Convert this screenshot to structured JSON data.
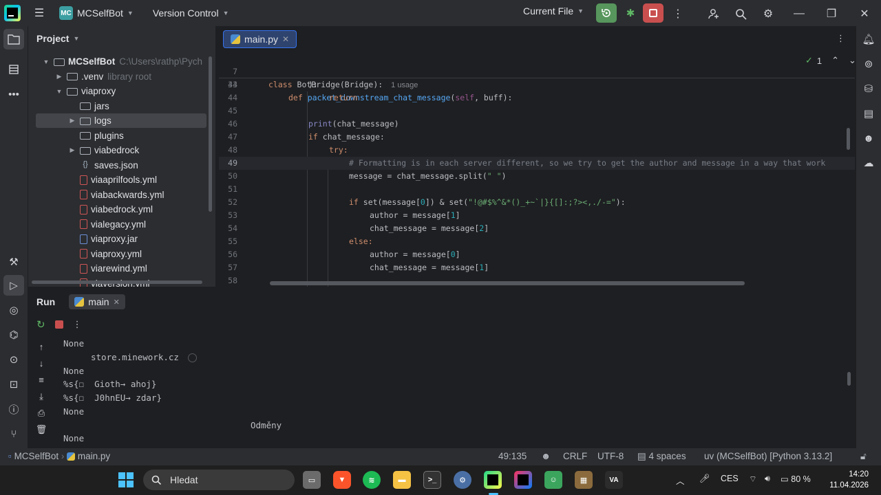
{
  "titlebar": {
    "project_badge": "MC",
    "project_name": "MCSelfBot",
    "vcs_label": "Version Control",
    "run_config": "Current File",
    "icons": [
      "pycharm-logo",
      "hamburger-menu-icon",
      "run-icon",
      "debug-icon",
      "stop-icon",
      "more-icon",
      "add-user-icon",
      "search-icon",
      "settings-icon",
      "minimize-icon",
      "maximize-icon",
      "close-icon"
    ]
  },
  "project": {
    "header": "Project",
    "tree": [
      {
        "label": "MCSelfBot",
        "hint": "C:\\Users\\rathp\\Pych",
        "type": "folder",
        "indent": 0,
        "arrow": "down"
      },
      {
        "label": ".venv",
        "hint": "library root",
        "type": "folder",
        "indent": 1,
        "arrow": "right"
      },
      {
        "label": "viaproxy",
        "hint": "",
        "type": "folder",
        "indent": 1,
        "arrow": "down"
      },
      {
        "label": "jars",
        "hint": "",
        "type": "folder",
        "indent": 2,
        "arrow": ""
      },
      {
        "label": "logs",
        "hint": "",
        "type": "folder",
        "indent": 2,
        "arrow": "right"
      },
      {
        "label": "plugins",
        "hint": "",
        "type": "folder",
        "indent": 2,
        "arrow": ""
      },
      {
        "label": "viabedrock",
        "hint": "",
        "type": "folder",
        "indent": 2,
        "arrow": "right"
      },
      {
        "label": "saves.json",
        "hint": "",
        "type": "json",
        "indent": 2,
        "arrow": ""
      },
      {
        "label": "viaaprilfools.yml",
        "hint": "",
        "type": "yml",
        "indent": 2,
        "arrow": ""
      },
      {
        "label": "viabackwards.yml",
        "hint": "",
        "type": "yml",
        "indent": 2,
        "arrow": ""
      },
      {
        "label": "viabedrock.yml",
        "hint": "",
        "type": "yml",
        "indent": 2,
        "arrow": ""
      },
      {
        "label": "vialegacy.yml",
        "hint": "",
        "type": "yml",
        "indent": 2,
        "arrow": ""
      },
      {
        "label": "viaproxy.jar",
        "hint": "",
        "type": "jar",
        "indent": 2,
        "arrow": ""
      },
      {
        "label": "viaproxy.yml",
        "hint": "",
        "type": "yml",
        "indent": 2,
        "arrow": ""
      },
      {
        "label": "viarewind.yml",
        "hint": "",
        "type": "yml",
        "indent": 2,
        "arrow": ""
      },
      {
        "label": "viaversion.yml",
        "hint": "",
        "type": "yml",
        "indent": 2,
        "arrow": ""
      }
    ]
  },
  "editor": {
    "tab_label": "main.py",
    "inspection_count": "1",
    "sticky": [
      {
        "ln": "7",
        "html_key": "s7"
      },
      {
        "ln": "34",
        "html_key": "s34"
      }
    ],
    "usage_hint": "1 usage",
    "lines": {
      "n43": "43",
      "n44": "44",
      "n45": "45",
      "n46": "46",
      "n47": "47",
      "n48": "48",
      "n49": "49",
      "n50": "50",
      "n51": "51",
      "n52": "52",
      "n53": "53",
      "n54": "54",
      "n55": "55",
      "n56": "56",
      "n57": "57",
      "n58": "58"
    },
    "code": {
      "s7_kw": "class ",
      "s7_name": "BotBridge",
      "s7_rest": "(Bridge):",
      "s34_kw": "def ",
      "s34_name": "packet_downstream_chat_message",
      "s34_open": "(",
      "s34_self": "self",
      "s34_rest": ", buff):",
      "l43": "):",
      "l44": "return",
      "l46_fn": "print",
      "l46_rest": "(chat_message)",
      "l47_kw": "if ",
      "l47_rest": "chat_message:",
      "l48": "try:",
      "l49": "# Formatting is in each server different, so we try to get the author and message in a way that work",
      "l50_a": "message = chat_message.split(",
      "l50_str": "\" \"",
      "l50_b": ")",
      "l52_kw": "if ",
      "l52_a": "set(message[",
      "l52_n": "0",
      "l52_b": "]) & set(",
      "l52_str": "\"!@#$%^&*()_+~`|}{[]:;?><,./-=\"",
      "l52_c": "):",
      "l53_a": "author = message[",
      "l53_n": "1",
      "l53_b": "]",
      "l54_a": "chat_message = message[",
      "l54_n": "2",
      "l54_b": "]",
      "l55": "else:",
      "l56_a": "author = message[",
      "l56_n": "0",
      "l56_b": "]",
      "l57_a": "chat_message = message[",
      "l57_n": "1",
      "l57_b": "]"
    }
  },
  "run": {
    "title": "Run",
    "tab_label": "main",
    "output": [
      "None",
      "store.minework.cz",
      "None",
      "%s{☐  Gioth→ ahoj}",
      "%s{☐  J0hnEU→ zdar}",
      "None",
      "Odměny",
      "None"
    ]
  },
  "statusbar": {
    "project": "MCSelfBot",
    "file": "main.py",
    "position": "49:135",
    "line_sep": "CRLF",
    "encoding": "UTF-8",
    "indent": "4 spaces",
    "interpreter": "uv (MCSelfBot) [Python 3.13.2]"
  },
  "taskbar": {
    "search_placeholder": "Hledat",
    "language": "CES",
    "battery": "80 %",
    "time": "14:20",
    "date": "11.04.2026",
    "apps": [
      "windows-start",
      "explorer-app",
      "brave-app",
      "spotify-app",
      "files-app",
      "terminal-app",
      "settings-app",
      "pycharm-app",
      "intellij-app",
      "discord-app",
      "minecraft-app",
      "viaproxy-app"
    ]
  }
}
